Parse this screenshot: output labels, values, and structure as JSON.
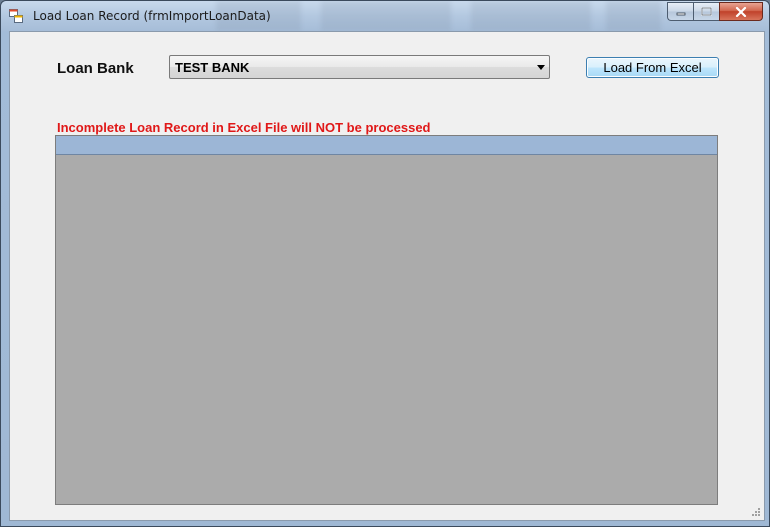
{
  "window": {
    "title": "Load Loan Record (frmImportLoanData)"
  },
  "form": {
    "loan_bank_label": "Loan Bank",
    "loan_bank_value": "TEST BANK",
    "load_button_label": "Load From Excel",
    "warning_text": "Incomplete Loan Record in Excel File will NOT be processed"
  },
  "colors": {
    "warning": "#e01818",
    "grid_background": "#ababab",
    "grid_header": "#9cb6d6"
  },
  "icons": {
    "app": "form-window-icon",
    "minimize": "minimize-icon",
    "maximize": "maximize-icon",
    "close": "close-icon",
    "dropdown": "chevron-down-icon"
  }
}
